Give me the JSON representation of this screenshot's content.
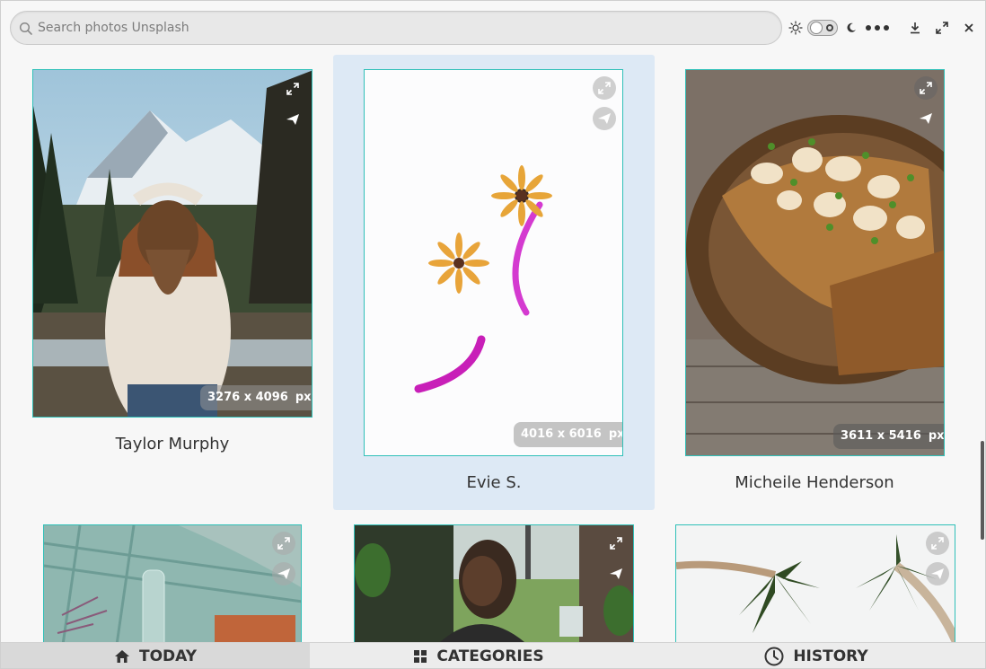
{
  "search": {
    "placeholder": "Search photos Unsplash",
    "icon": "magnifier"
  },
  "header_icons": [
    "sun-icon",
    "theme-toggle",
    "moon-icon",
    "more-icon",
    "download-icon",
    "maximize-icon",
    "close-icon"
  ],
  "photos": [
    {
      "author": "Taylor Murphy",
      "dims": "3276 x 4096",
      "unit": "px"
    },
    {
      "author": "Evie S.",
      "dims": "4016 x 6016",
      "unit": "px",
      "selected": true
    },
    {
      "author": "Micheile Henderson",
      "dims": "3611 x 5416",
      "unit": "px"
    },
    {
      "author": "",
      "dims": "",
      "unit": ""
    },
    {
      "author": "",
      "dims": "",
      "unit": ""
    },
    {
      "author": "",
      "dims": "",
      "unit": ""
    }
  ],
  "tabs": [
    {
      "label": "TODAY",
      "icon": "home-icon",
      "active": true
    },
    {
      "label": "CATEGORIES",
      "icon": "grid-icon",
      "active": false
    },
    {
      "label": "HISTORY",
      "icon": "clock-icon",
      "active": false
    }
  ],
  "colors": {
    "selected_bg": "#dde9f5",
    "photo_border": "#2fc0b8",
    "window_bg": "#f7f7f7"
  }
}
